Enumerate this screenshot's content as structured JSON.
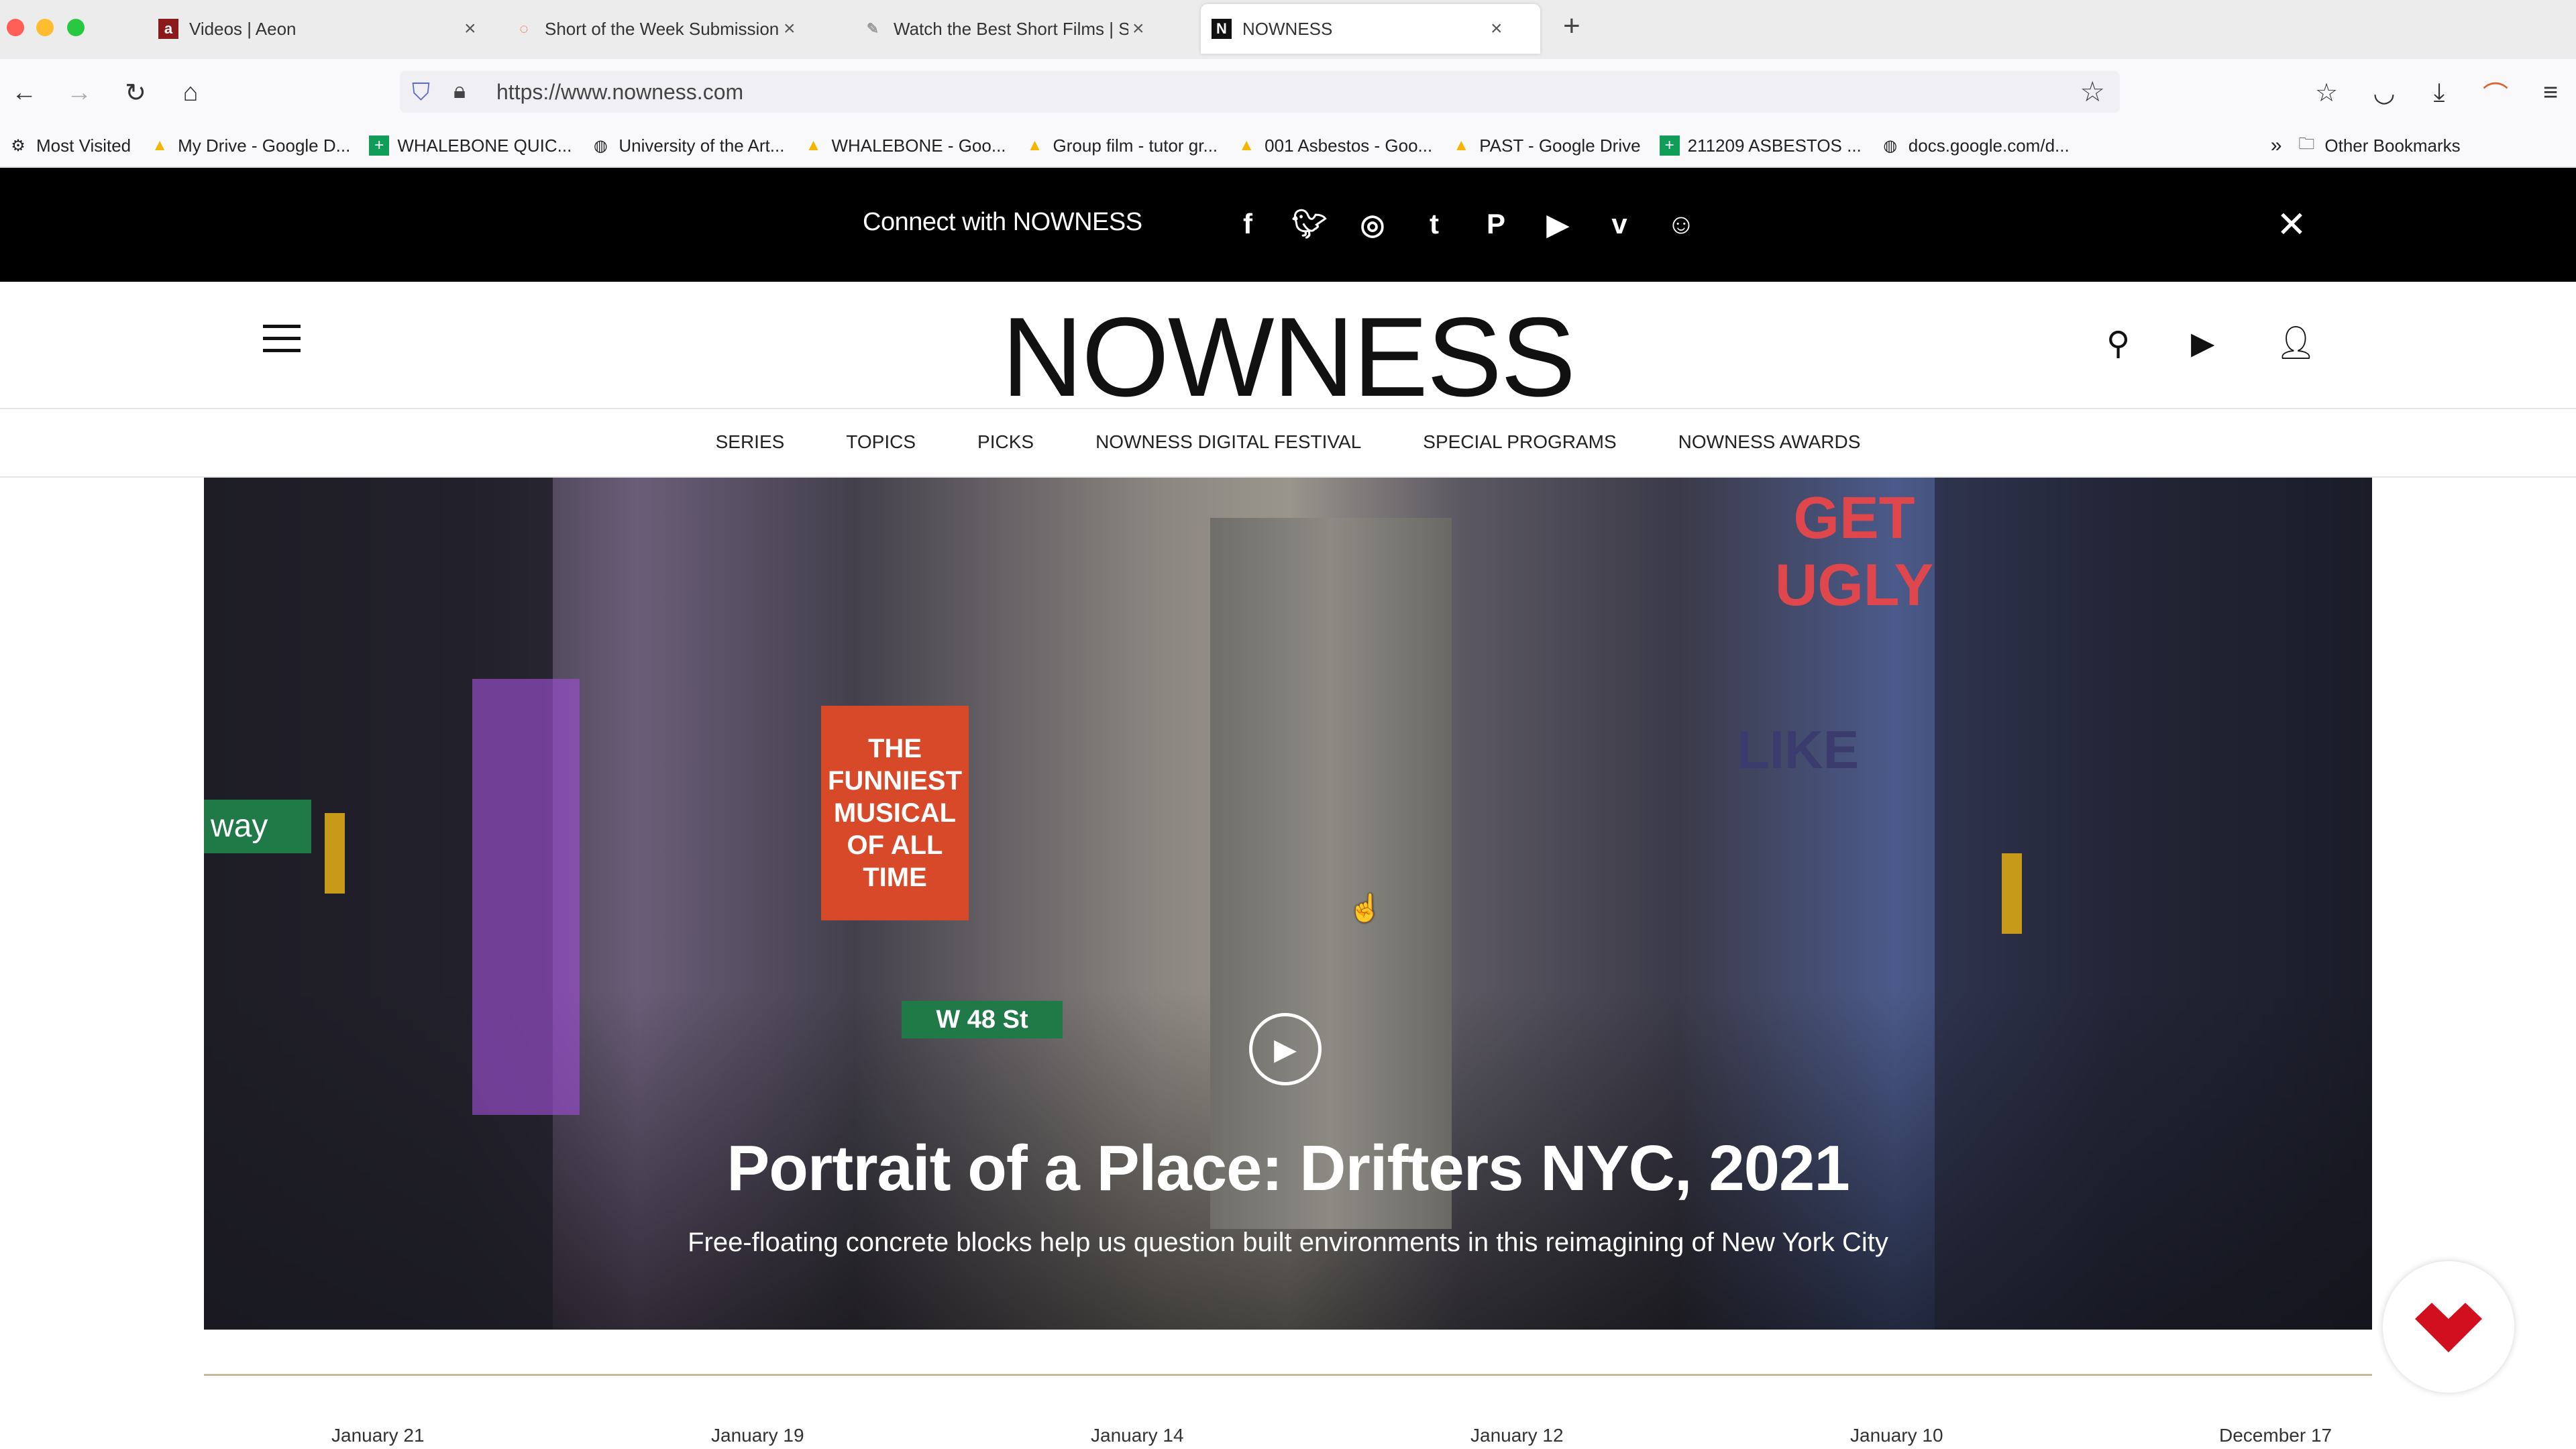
{
  "browser": {
    "tabs": [
      {
        "title": "Videos | Aeon",
        "icon": "a"
      },
      {
        "title": "Short of the Week Submission M",
        "icon": "◌"
      },
      {
        "title": "Watch the Best Short Films | Sh",
        "icon": "✎"
      },
      {
        "title": "NOWNESS",
        "icon": "N",
        "active": true
      }
    ],
    "new_tab": "+",
    "url": "https://www.nowness.com",
    "bookmarks": [
      "Most Visited",
      "My Drive - Google D...",
      "WHALEBONE QUIC...",
      "University of the Art...",
      "WHALEBONE - Goo...",
      "Group film - tutor gr...",
      "001 Asbestos - Goo...",
      "PAST - Google Drive",
      "211209 ASBESTOS ...",
      "docs.google.com/d..."
    ],
    "other_bookmarks": "Other Bookmarks"
  },
  "connect": {
    "text": "Connect with NOWNESS",
    "socials": [
      "facebook",
      "twitter",
      "instagram",
      "tumblr",
      "pinterest",
      "youtube",
      "vimeo",
      "wechat"
    ]
  },
  "site": {
    "logo": "NOWNESS",
    "menu": [
      "SERIES",
      "TOPICS",
      "PICKS",
      "NOWNESS DIGITAL FESTIVAL",
      "SPECIAL PROGRAMS",
      "NOWNESS AWARDS"
    ]
  },
  "hero": {
    "title": "Portrait of a Place: Drifters NYC, 2021",
    "subtitle": "Free-floating concrete blocks help us question built environments in this reimagining of New York City",
    "signs": {
      "street": "W 48 St",
      "way": "way",
      "get_ugly": "GET UGLY",
      "like": "LIKE",
      "musical": "THE FUNNIEST MUSICAL OF ALL TIME"
    }
  },
  "dates": [
    "January 21",
    "January 19",
    "January 14",
    "January 12",
    "January 10",
    "December 17"
  ],
  "colors": {
    "accent": "#c9b99a",
    "fab_red": "#d10f1f",
    "connect_bg": "#000000"
  }
}
